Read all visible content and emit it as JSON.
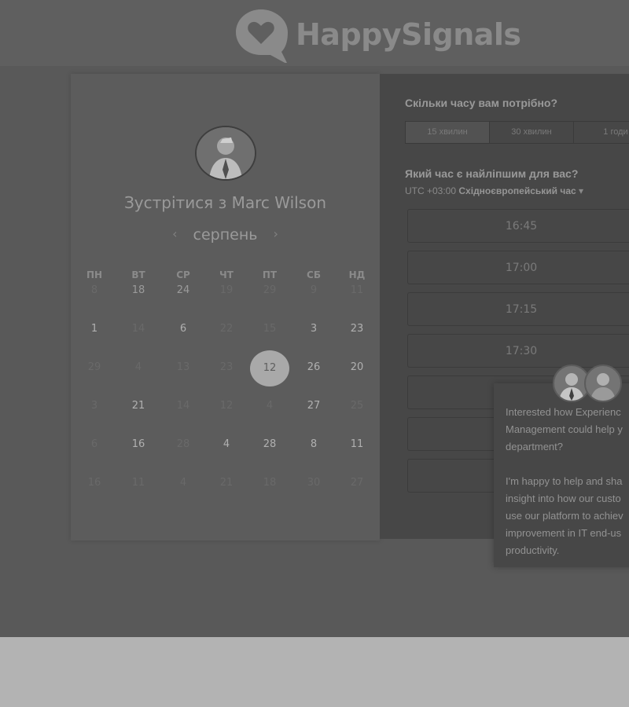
{
  "brand": {
    "name": "HappySignals"
  },
  "calendar": {
    "heading_prefix": "Зустрітися з",
    "heading_name": "Marc Wilson",
    "month": "серпень",
    "prev_icon": "‹",
    "next_icon": "›",
    "weekdays": [
      "ПН",
      "ВТ",
      "СР",
      "ЧТ",
      "ПТ",
      "СБ",
      "НД"
    ],
    "weeks": [
      [
        {
          "d": "8",
          "m": true
        },
        {
          "d": "18"
        },
        {
          "d": "24"
        },
        {
          "d": "19",
          "m": true
        },
        {
          "d": "29",
          "m": true
        },
        {
          "d": "9",
          "m": true
        },
        {
          "d": "11",
          "m": true
        }
      ],
      [
        {
          "d": "1",
          "b": true
        },
        {
          "d": "14",
          "m": true
        },
        {
          "d": "6",
          "b": true
        },
        {
          "d": "22",
          "m": true
        },
        {
          "d": "15",
          "m": true
        },
        {
          "d": "3",
          "b": true
        },
        {
          "d": "23",
          "b": true
        }
      ],
      [
        {
          "d": "29",
          "m": true
        },
        {
          "d": "4",
          "m": true
        },
        {
          "d": "13",
          "m": true
        },
        {
          "d": "23",
          "m": true
        },
        {
          "d": "12",
          "sel": true
        },
        {
          "d": "26",
          "b": true
        },
        {
          "d": "20",
          "b": true
        }
      ],
      [
        {
          "d": "3",
          "m": true
        },
        {
          "d": "21",
          "b": true
        },
        {
          "d": "14",
          "m": true
        },
        {
          "d": "12",
          "m": true
        },
        {
          "d": "4",
          "m": true
        },
        {
          "d": "27",
          "b": true
        },
        {
          "d": "25",
          "m": true
        }
      ],
      [
        {
          "d": "6",
          "m": true
        },
        {
          "d": "16",
          "b": true
        },
        {
          "d": "28",
          "m": true
        },
        {
          "d": "4",
          "b": true
        },
        {
          "d": "28",
          "b": true
        },
        {
          "d": "8",
          "b": true
        },
        {
          "d": "11",
          "b": true
        }
      ],
      [
        {
          "d": "16",
          "m": true
        },
        {
          "d": "11",
          "m": true
        },
        {
          "d": "4",
          "m": true
        },
        {
          "d": "21",
          "m": true
        },
        {
          "d": "18",
          "m": true
        },
        {
          "d": "30",
          "m": true
        },
        {
          "d": "27",
          "m": true
        }
      ]
    ]
  },
  "booking": {
    "duration_question": "Скільки часу вам потрібно?",
    "durations": [
      "15 хвилин",
      "30 хвилин",
      "1 годи"
    ],
    "time_question": "Який час є найліпшим для вас?",
    "timezone_offset": "UTC +03:00",
    "timezone_name": "Східноєвропейський час",
    "timezone_caret": "▾",
    "slots": [
      "16:45",
      "17:00",
      "17:15",
      "17:30",
      "",
      "",
      ""
    ]
  },
  "chat": {
    "message": "Interested how Experienc\nManagement could help y\ndepartment?\n\nI'm happy to help and sha\ninsight into how our custo\nuse our platform to achiev\nimprovement in IT end-us\nproductivity."
  }
}
